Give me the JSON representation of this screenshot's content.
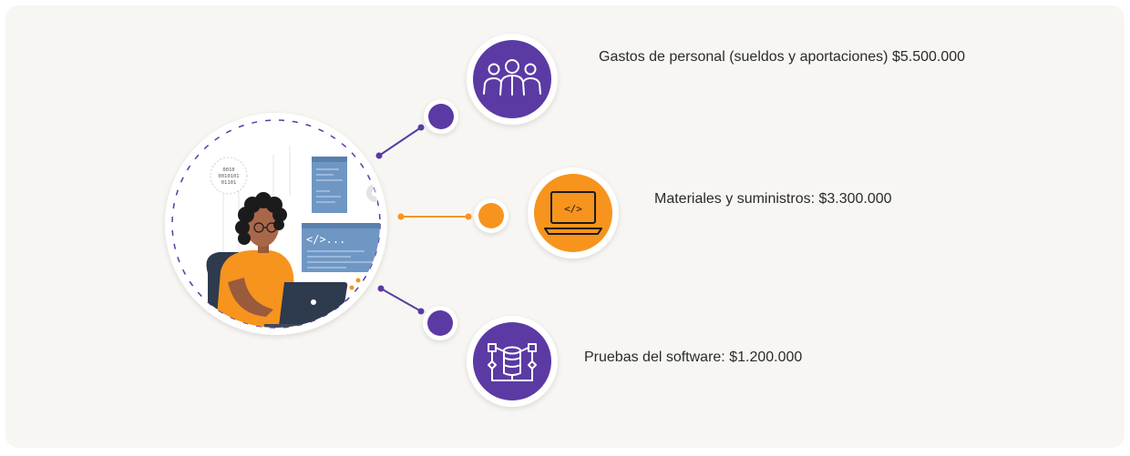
{
  "items": [
    {
      "label": "Gastos de personal (sueldos y aportaciones) $5.500.000",
      "icon": "team-icon",
      "color": "#5b3aa4"
    },
    {
      "label": "Materiales y suministros: $3.300.000",
      "icon": "laptop-code-icon",
      "color": "#f7941d"
    },
    {
      "label": "Pruebas del software: $1.200.000",
      "icon": "database-flow-icon",
      "color": "#5b3aa4"
    }
  ],
  "illustration": {
    "icon": "developer-illustration",
    "binary_lines": [
      "0010",
      "0010101",
      "01101"
    ],
    "code_tag": "</>..."
  },
  "colors": {
    "purple": "#5b3aa4",
    "orange": "#f7941d",
    "panel": "#f7f6f3"
  }
}
